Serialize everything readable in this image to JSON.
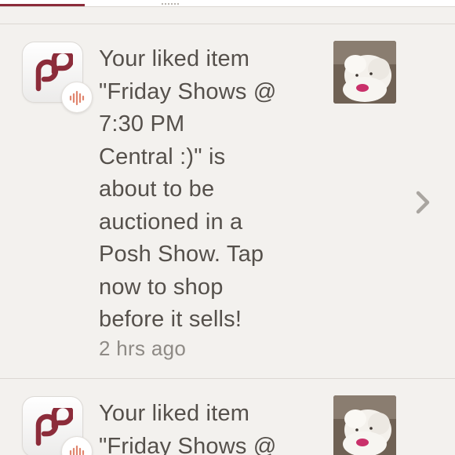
{
  "colors": {
    "brand": "#8c2c3a",
    "text": "#55504b",
    "muted": "#8e8a85",
    "background": "#f3f1ee",
    "badge_accent": "#e0866f"
  },
  "notifications": [
    {
      "icon": "poshmark-logo-icon",
      "badge_icon": "audio-wave-icon",
      "message": "Your liked item\n\"Friday Shows @\n7:30 PM\nCentral :)\" is\nabout to be\nauctioned in a\nPosh Show. Tap\nnow to shop\nbefore it sells!",
      "time": "2 hrs ago",
      "thumbnail": "liked-item-thumbnail",
      "action_icon": "chevron-right-icon"
    },
    {
      "icon": "poshmark-logo-icon",
      "badge_icon": "audio-wave-icon",
      "message": "Your liked item\n\"Friday Shows @",
      "thumbnail": "liked-item-thumbnail"
    }
  ]
}
